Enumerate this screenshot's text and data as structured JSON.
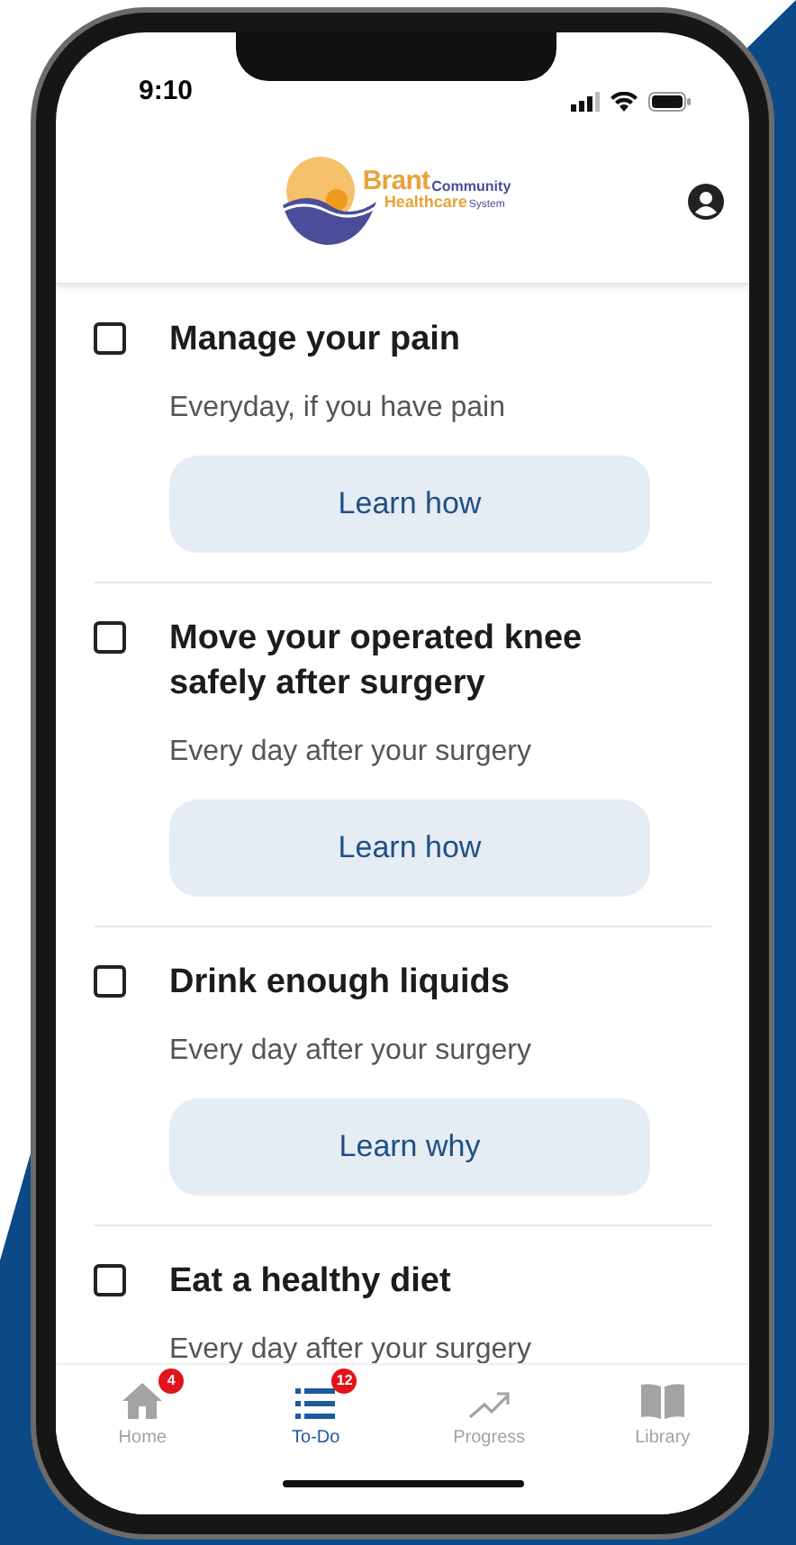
{
  "status_bar": {
    "time": "9:10"
  },
  "header": {
    "logo": {
      "brand": "Brant",
      "line_1": "Community",
      "line_2": "Healthcare",
      "line_3": "System"
    }
  },
  "tasks": [
    {
      "title": "Manage your pain",
      "checked": false,
      "schedule": "Everyday, if you have pain",
      "action": "Learn how"
    },
    {
      "title": "Move your operated knee safely after surgery",
      "checked": false,
      "schedule": "Every day after your surgery",
      "action": "Learn how"
    },
    {
      "title": "Drink enough liquids",
      "checked": false,
      "schedule": "Every day after your surgery",
      "action": "Learn why"
    },
    {
      "title": "Eat a healthy diet",
      "checked": false,
      "schedule": "Every day after your surgery"
    }
  ],
  "tab_bar": [
    {
      "kind": "home",
      "label": "Home",
      "badge": "4",
      "selected": false
    },
    {
      "kind": "todo",
      "label": "To-Do",
      "badge": "12",
      "selected": true
    },
    {
      "kind": "progress",
      "label": "Progress",
      "selected": false
    },
    {
      "kind": "library",
      "label": "Library",
      "selected": false
    }
  ]
}
